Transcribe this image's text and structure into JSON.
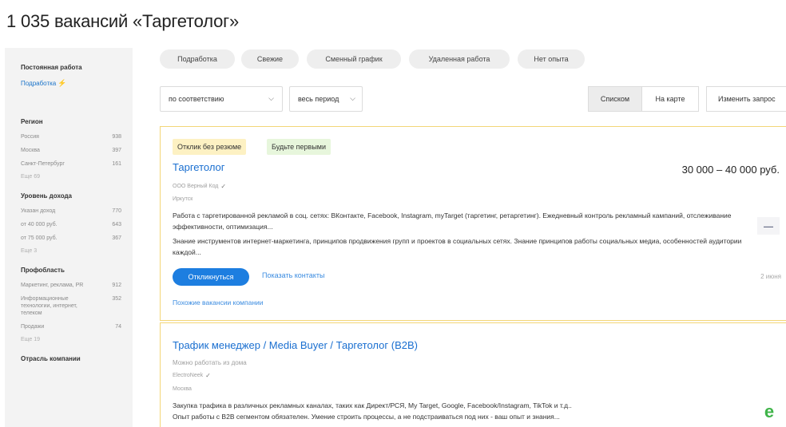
{
  "header": {
    "title": "1 035 вакансий «Таргетолог»"
  },
  "sidebar": {
    "employment_heading": "Постоянная работа",
    "employment_link": "Подработка",
    "region": {
      "heading": "Регион",
      "items": [
        {
          "label": "Россия",
          "count": "938"
        },
        {
          "label": "Москва",
          "count": "397"
        },
        {
          "label": "Санкт-Петербург",
          "count": "161"
        }
      ],
      "more": "Еще 69"
    },
    "income": {
      "heading": "Уровень дохода",
      "items": [
        {
          "label": "Указан доход",
          "count": "770"
        },
        {
          "label": "от 40 000 руб.",
          "count": "643"
        },
        {
          "label": "от 75 000 руб.",
          "count": "367"
        }
      ],
      "more": "Еще 3"
    },
    "profarea": {
      "heading": "Профобласть",
      "items": [
        {
          "label": "Маркетинг, реклама, PR",
          "count": "912"
        },
        {
          "label": "Информационные технологии, интернет, телеком",
          "count": "352"
        },
        {
          "label": "Продажи",
          "count": "74"
        }
      ],
      "more": "Еще 19"
    },
    "industry_heading": "Отрасль компании"
  },
  "chips": [
    "Подработка",
    "Свежие",
    "Сменный график",
    "Удаленная работа",
    "Нет опыта"
  ],
  "controls": {
    "sort_value": "по соответствию",
    "period_value": "весь период",
    "view_list": "Списком",
    "view_map": "На карте",
    "change_query": "Изменить запрос"
  },
  "vacancies": [
    {
      "badges": [
        "Отклик без резюме",
        "Будьте первыми"
      ],
      "title": "Таргетолог",
      "salary": "30 000 – 40 000 руб.",
      "company": "ООО Верный Код",
      "city": "Иркутск",
      "description": "Работа с таргетированной рекламой в соц. сетях: ВКонтакте, Facebook, Instagram, myTarget (таргетинг, ретаргетинг). Ежедневный контроль рекламный кампаний, отслеживание эффективности, оптимизация...",
      "requirements": "Знание инструментов интернет-маркетинга, принципов продвижения групп и проектов в социальных сетях. Знание принципов работы социальных медиа, особенностей аудитории каждой...",
      "apply": "Откликнуться",
      "show_contacts": "Показать контакты",
      "date": "2 июня",
      "similar": "Похожие вакансии компании"
    },
    {
      "title": "Трафик менеджер / Media Buyer / Таргетолог (B2B)",
      "remote": "Можно работать из дома",
      "company": "ElectroNeek",
      "city": "Москва",
      "description": "Закупка трафика в различных рекламных каналах, таких как Директ/РСЯ, My Target, Google, Facebook/Instagram, TikTok и т.д..",
      "requirements": "Опыт работы с B2B сегментом обязателен. Умение строить процессы, а не подстраиваться под них - ваш опыт и знания..."
    }
  ],
  "colors": {
    "accent": "#1d7ee0",
    "link": "#1a6fd0",
    "card_border": "#f3d678"
  }
}
